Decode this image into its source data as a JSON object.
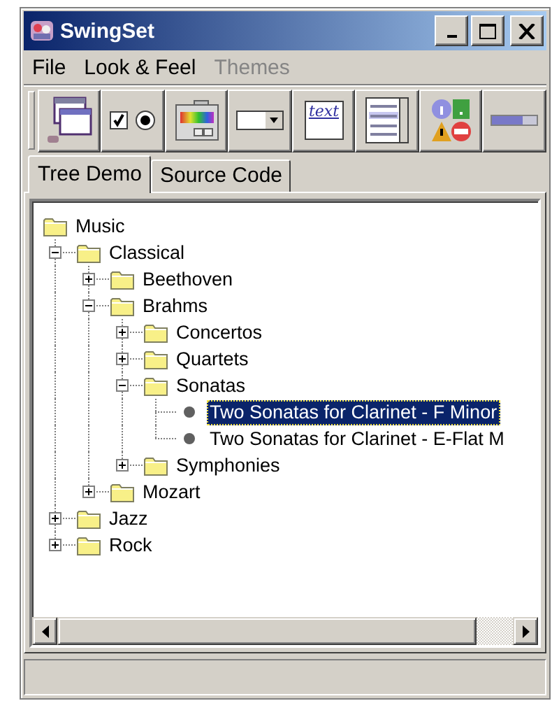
{
  "window": {
    "title": "SwingSet"
  },
  "menu": [
    {
      "label": "File",
      "disabled": false
    },
    {
      "label": "Look & Feel",
      "disabled": false
    },
    {
      "label": "Themes",
      "disabled": true
    }
  ],
  "toolbar": [
    {
      "kind": "frames"
    },
    {
      "kind": "toggles"
    },
    {
      "kind": "colors"
    },
    {
      "kind": "combo"
    },
    {
      "kind": "text",
      "label": "text"
    },
    {
      "kind": "list"
    },
    {
      "kind": "dialogs"
    },
    {
      "kind": "progress"
    }
  ],
  "tabs": [
    {
      "label": "Tree Demo",
      "selected": true
    },
    {
      "label": "Source Code",
      "selected": false
    }
  ],
  "tree": [
    {
      "label": "Music",
      "kind": "folder",
      "selected": false,
      "children": [
        {
          "label": "Classical",
          "kind": "folder",
          "expanded": true,
          "selected": false,
          "children": [
            {
              "label": "Beethoven",
              "kind": "folder",
              "expanded": false,
              "selected": false
            },
            {
              "label": "Brahms",
              "kind": "folder",
              "expanded": true,
              "selected": false,
              "children": [
                {
                  "label": "Concertos",
                  "kind": "folder",
                  "expanded": false,
                  "selected": false
                },
                {
                  "label": "Quartets",
                  "kind": "folder",
                  "expanded": false,
                  "selected": false
                },
                {
                  "label": "Sonatas",
                  "kind": "folder",
                  "expanded": true,
                  "selected": false,
                  "children": [
                    {
                      "label": "Two Sonatas for Clarinet - F Minor",
                      "kind": "leaf",
                      "selected": true
                    },
                    {
                      "label": "Two Sonatas for Clarinet - E-Flat M",
                      "kind": "leaf",
                      "selected": false
                    }
                  ]
                },
                {
                  "label": "Symphonies",
                  "kind": "folder",
                  "expanded": false,
                  "selected": false
                }
              ]
            },
            {
              "label": "Mozart",
              "kind": "folder",
              "expanded": false,
              "selected": false
            }
          ]
        },
        {
          "label": "Jazz",
          "kind": "folder",
          "expanded": false,
          "selected": false
        },
        {
          "label": "Rock",
          "kind": "folder",
          "expanded": false,
          "selected": false
        }
      ]
    }
  ]
}
